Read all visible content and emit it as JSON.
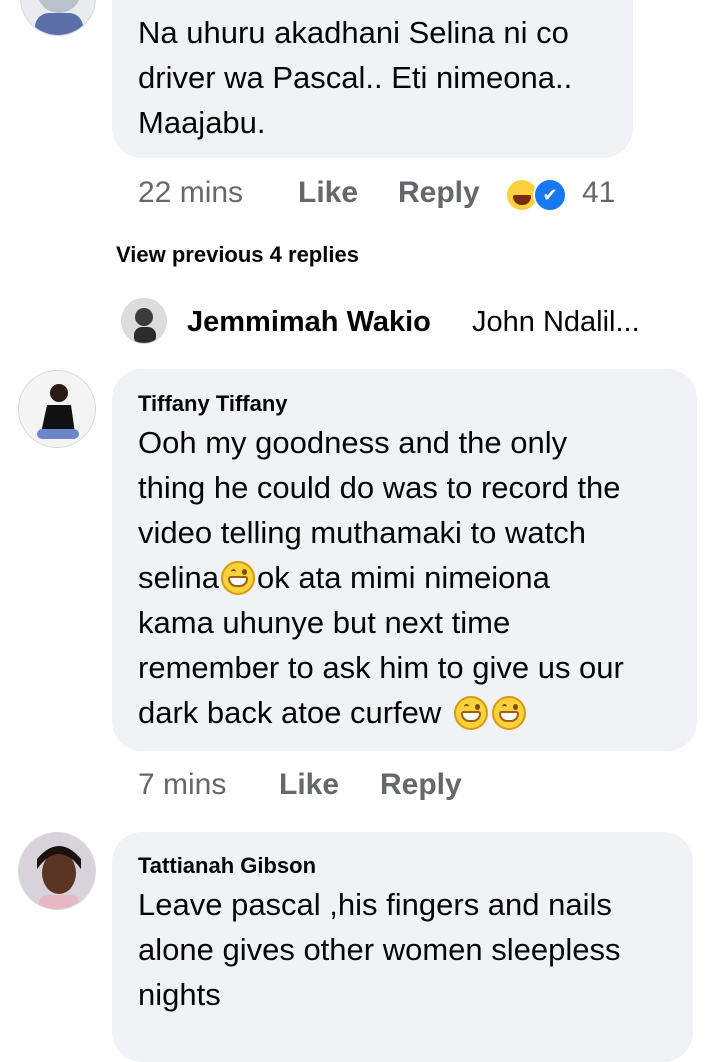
{
  "comments": [
    {
      "text_lines": [
        "Na uhuru akadhani Selina ni co",
        "driver wa Pascal.. Eti nimeona..",
        "Maajabu."
      ],
      "time": "22 mins",
      "like_label": "Like",
      "reply_label": "Reply",
      "reaction_count": "41"
    },
    {
      "author": "Tiffany Tiffany",
      "text_lines": [
        "Ooh my goodness and the only",
        "thing he could do was to record the",
        "video telling muthamaki to watch",
        "selina",
        "ok  ata mimi nimeiona",
        "kama uhunye but next time",
        "remember to ask him to give us our",
        "dark back atoe curfew"
      ],
      "time": "7 mins",
      "like_label": "Like",
      "reply_label": "Reply"
    },
    {
      "author": "Tattianah Gibson",
      "text_lines": [
        "Leave pascal ,his fingers and nails",
        "alone gives other women sleepless",
        "nights"
      ]
    }
  ],
  "view_previous": "View previous 4 replies",
  "reply_preview": {
    "author": "Jemmimah Wakio",
    "snippet": "John Ndalil..."
  },
  "colors": {
    "bubble": "#f0f2f5",
    "meta": "#65676b",
    "text": "#050505",
    "like_blue": "#1877f2"
  }
}
